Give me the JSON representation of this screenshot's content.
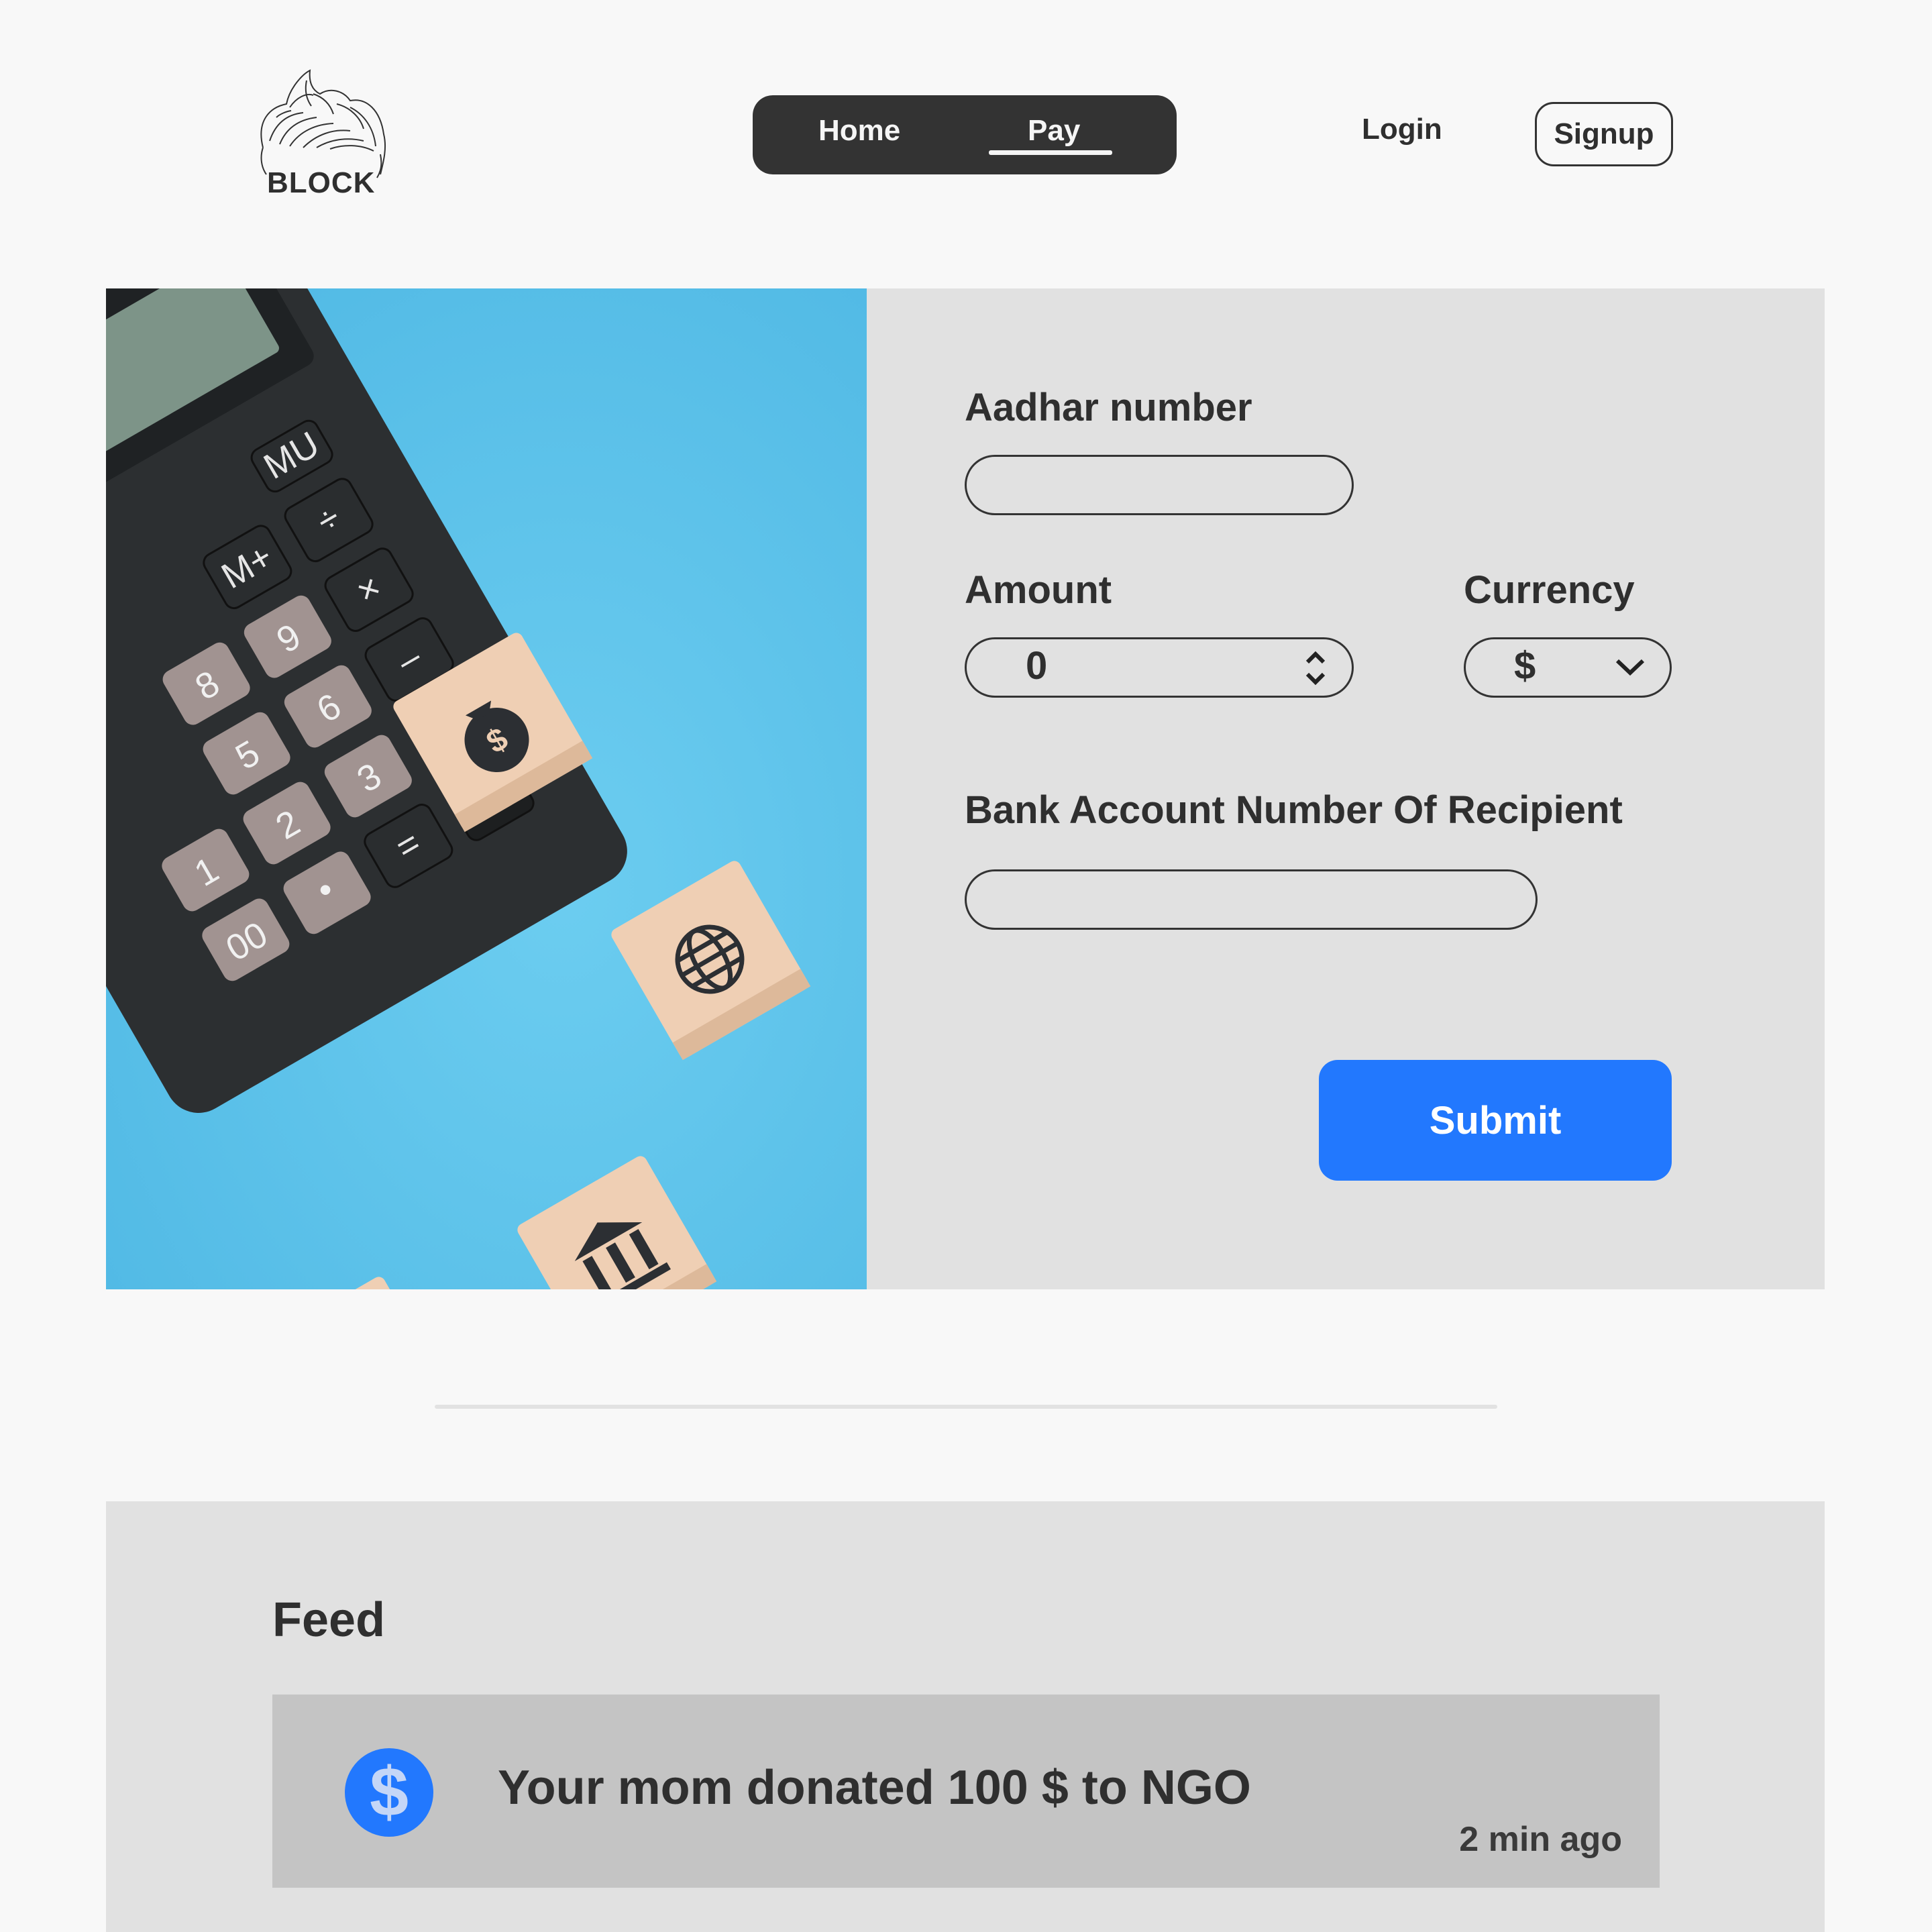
{
  "header": {
    "logo_text": "BLOCK",
    "nav": [
      {
        "label": "Home"
      },
      {
        "label": "Pay"
      }
    ],
    "login_label": "Login",
    "signup_label": "Signup"
  },
  "hero": {
    "calculator_keys": [
      "MU",
      "%",
      "÷",
      "M+",
      "×",
      "9",
      "8",
      "6",
      "–",
      "5",
      "3",
      "+",
      "2",
      "1",
      "=",
      "•",
      "00"
    ]
  },
  "form": {
    "aadhar_label": "Aadhar number",
    "aadhar_value": "",
    "amount_label": "Amount",
    "amount_value": "0",
    "currency_label": "Currency",
    "currency_value": "$",
    "bank_label": "Bank Account Number Of Recipient",
    "bank_value": "",
    "submit_label": "Submit"
  },
  "feed": {
    "title": "Feed",
    "items": [
      {
        "icon_symbol": "$",
        "text": "Your mom donated 100 $ to NGO",
        "time": "2 min ago"
      }
    ]
  },
  "colors": {
    "accent": "#2278fe",
    "nav_bg": "#333333",
    "hero_blue": "#5fc2ea",
    "panel_gray": "#e1e1e1",
    "feed_item": "#c4c4c4"
  },
  "icons": [
    "logo-hair-icon",
    "money-bag-icon",
    "globe-icon",
    "bank-icon",
    "briefcase-icon",
    "stepper-icon",
    "chevron-down-icon",
    "dollar-icon"
  ]
}
